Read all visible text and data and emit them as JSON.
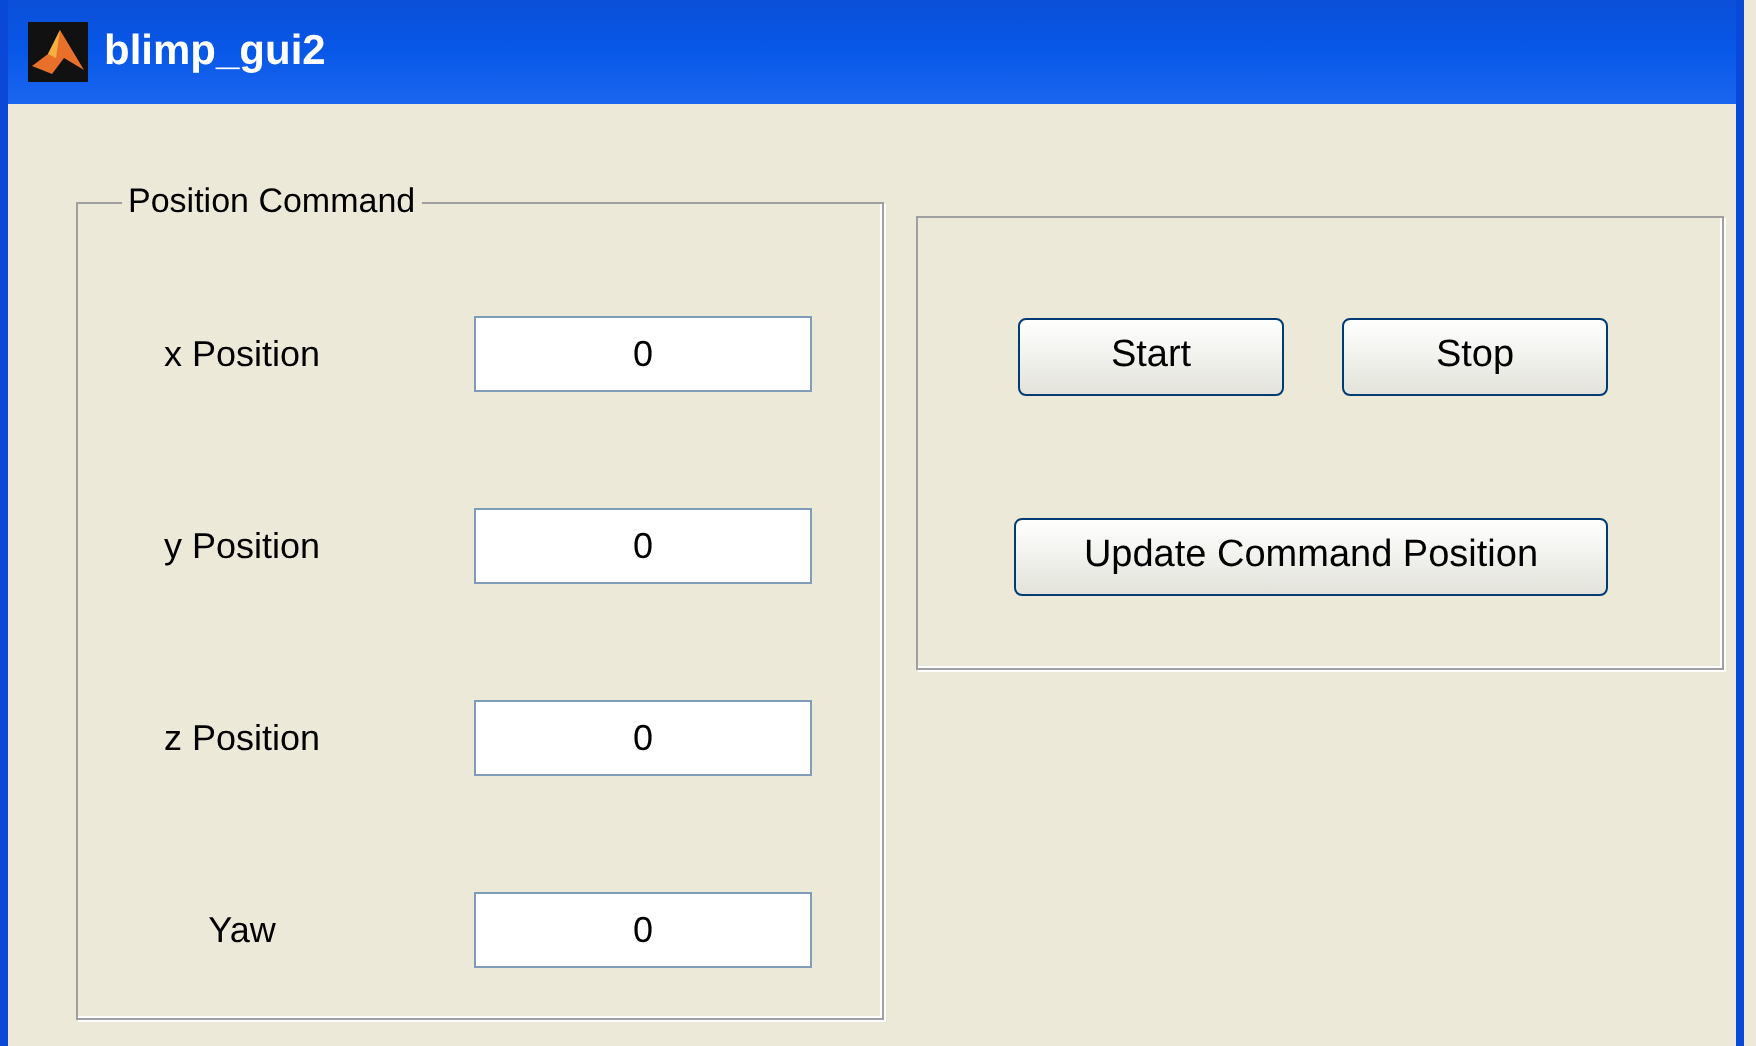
{
  "window": {
    "title": "blimp_gui2"
  },
  "position_panel": {
    "title": "Position Command",
    "fields": [
      {
        "label": "x Position",
        "value": "0"
      },
      {
        "label": "y Position",
        "value": "0"
      },
      {
        "label": "z Position",
        "value": "0"
      },
      {
        "label": "Yaw",
        "value": "0"
      }
    ]
  },
  "control_panel": {
    "top_buttons": [
      "Start",
      "Stop"
    ],
    "bottom_buttons": [
      "Update Command Position"
    ]
  }
}
